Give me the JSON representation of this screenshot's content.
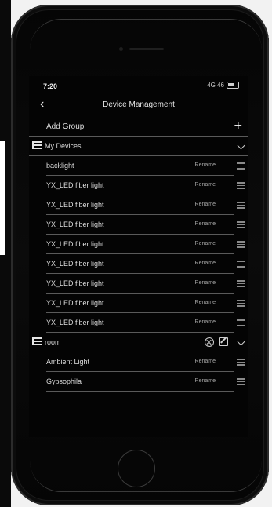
{
  "status_bar": {
    "time": "7:20",
    "signal": "4G 46"
  },
  "nav": {
    "back_label": "‹",
    "title": "Device Management"
  },
  "add_group": {
    "label": "Add Group",
    "plus": "+"
  },
  "groups": [
    {
      "name": "My Devices",
      "devices": [
        {
          "name": "backlight",
          "action": "Rename"
        },
        {
          "name": "YX_LED fiber light",
          "action": "Rename"
        },
        {
          "name": "YX_LED fiber light",
          "action": "Rename"
        },
        {
          "name": "YX_LED fiber light",
          "action": "Rename"
        },
        {
          "name": "YX_LED fiber light",
          "action": "Rename"
        },
        {
          "name": "YX_LED fiber light",
          "action": "Rename"
        },
        {
          "name": "YX_LED fiber light",
          "action": "Rename"
        },
        {
          "name": "YX_LED fiber light",
          "action": "Rename"
        },
        {
          "name": "YX_LED fiber light",
          "action": "Rename"
        }
      ]
    },
    {
      "name": "room",
      "devices": [
        {
          "name": "Ambient Light",
          "action": "Rename"
        },
        {
          "name": "Gypsophila",
          "action": "Rename"
        }
      ]
    }
  ]
}
